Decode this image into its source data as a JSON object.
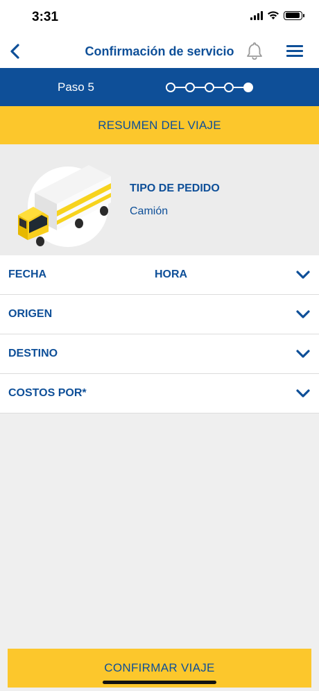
{
  "status_bar": {
    "time": "3:31"
  },
  "nav": {
    "title": "Confirmación de servicio",
    "back_icon": "chevron-left-icon",
    "notification_icon": "bell-icon",
    "menu_icon": "hamburger-menu-icon"
  },
  "progress": {
    "step_label": "Paso 5",
    "total_steps": 5,
    "current_step": 5
  },
  "summary": {
    "title": "RESUMEN DEL VIAJE"
  },
  "order": {
    "type_label": "TIPO DE PEDIDO",
    "type_value": "Camión",
    "illustration": "truck-icon"
  },
  "details": {
    "rows": [
      {
        "label": "FECHA",
        "secondary": "HORA"
      },
      {
        "label": "ORIGEN"
      },
      {
        "label": "DESTINO"
      },
      {
        "label": "COSTOS POR*"
      }
    ]
  },
  "actions": {
    "confirm_label": "CONFIRMAR VIAJE"
  },
  "colors": {
    "primary_blue": "#0e4f98",
    "accent_yellow": "#fcc72c",
    "background_gray": "#efefef"
  }
}
